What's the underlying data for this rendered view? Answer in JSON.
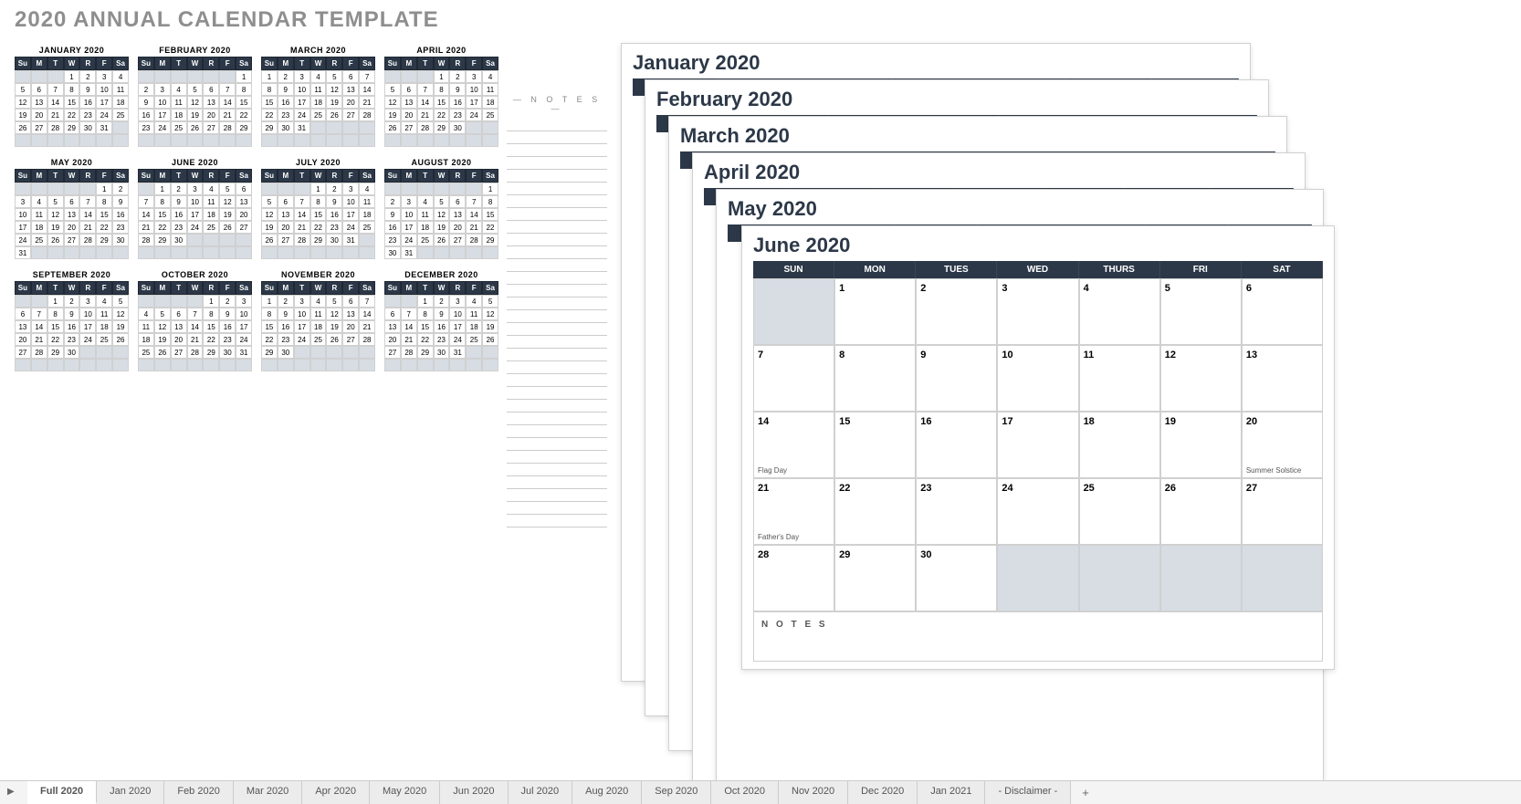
{
  "title": "2020 ANNUAL CALENDAR TEMPLATE",
  "dayHeadersMini": [
    "Su",
    "M",
    "T",
    "W",
    "R",
    "F",
    "Sa"
  ],
  "dayHeadersBig": [
    "SUN",
    "MON",
    "TUES",
    "WED",
    "THURS",
    "FRI",
    "SAT"
  ],
  "notesLabel": "— N O T E S —",
  "bigNotesLabel": "N O T E S",
  "miniMonths": [
    {
      "name": "JANUARY 2020",
      "start": 3,
      "days": 31
    },
    {
      "name": "FEBRUARY 2020",
      "start": 6,
      "days": 29
    },
    {
      "name": "MARCH 2020",
      "start": 0,
      "days": 31
    },
    {
      "name": "APRIL 2020",
      "start": 3,
      "days": 30
    },
    {
      "name": "MAY 2020",
      "start": 5,
      "days": 31
    },
    {
      "name": "JUNE 2020",
      "start": 1,
      "days": 30
    },
    {
      "name": "JULY 2020",
      "start": 3,
      "days": 31
    },
    {
      "name": "AUGUST 2020",
      "start": 6,
      "days": 31
    },
    {
      "name": "SEPTEMBER 2020",
      "start": 2,
      "days": 30
    },
    {
      "name": "OCTOBER 2020",
      "start": 4,
      "days": 31
    },
    {
      "name": "NOVEMBER 2020",
      "start": 0,
      "days": 30
    },
    {
      "name": "DECEMBER 2020",
      "start": 2,
      "days": 31
    }
  ],
  "stackSheets": [
    {
      "title": "January 2020"
    },
    {
      "title": "February 2020"
    },
    {
      "title": "March 2020"
    },
    {
      "title": "April 2020"
    },
    {
      "title": "May 2020"
    }
  ],
  "topSheet": {
    "title": "June 2020",
    "start": 1,
    "days": 30,
    "events": {
      "14": "Flag Day",
      "20": "Summer Solstice",
      "21": "Father's Day"
    }
  },
  "tabs": [
    "Full 2020",
    "Jan 2020",
    "Feb 2020",
    "Mar 2020",
    "Apr 2020",
    "May 2020",
    "Jun 2020",
    "Jul 2020",
    "Aug 2020",
    "Sep 2020",
    "Oct 2020",
    "Nov 2020",
    "Dec 2020",
    "Jan 2021",
    "- Disclaimer -"
  ],
  "activeTab": 0,
  "addTab": "+"
}
